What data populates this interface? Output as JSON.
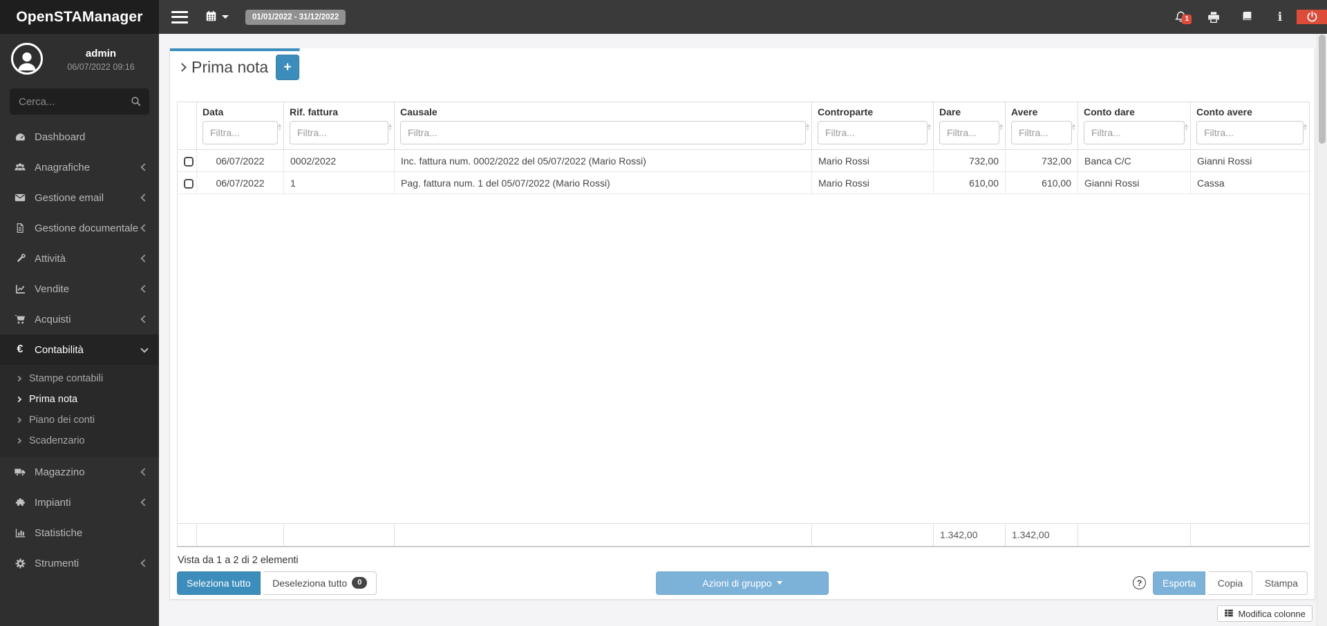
{
  "topbar": {
    "logo": "OpenSTAManager",
    "date_range": "01/01/2022 - 31/12/2022",
    "notification_count": "1"
  },
  "user": {
    "name": "admin",
    "last_login": "06/07/2022 09:16"
  },
  "sidebar": {
    "search_placeholder": "Cerca...",
    "items": [
      {
        "label": "Dashboard"
      },
      {
        "label": "Anagrafiche"
      },
      {
        "label": "Gestione email"
      },
      {
        "label": "Gestione documentale"
      },
      {
        "label": "Attività"
      },
      {
        "label": "Vendite"
      },
      {
        "label": "Acquisti"
      },
      {
        "label": "Contabilità",
        "submenu": [
          "Stampe contabili",
          "Prima nota",
          "Piano dei conti",
          "Scadenzario"
        ]
      },
      {
        "label": "Magazzino"
      },
      {
        "label": "Impianti"
      },
      {
        "label": "Statistiche"
      },
      {
        "label": "Strumenti"
      }
    ]
  },
  "main": {
    "tab_title": "Prima nota",
    "add_button": "+",
    "table": {
      "filter_placeholder": "Filtra...",
      "columns": [
        "Data",
        "Rif. fattura",
        "Causale",
        "Controparte",
        "Dare",
        "Avere",
        "Conto dare",
        "Conto avere"
      ],
      "rows": [
        [
          "06/07/2022",
          "0002/2022",
          "Inc. fattura num. 0002/2022 del 05/07/2022 (Mario Rossi)",
          "Mario Rossi",
          "732,00",
          "732,00",
          "Banca C/C",
          "Gianni Rossi"
        ],
        [
          "06/07/2022",
          "1",
          "Pag. fattura num. 1 del 05/07/2022 (Mario Rossi)",
          "Mario Rossi",
          "610,00",
          "610,00",
          "Gianni Rossi",
          "Cassa"
        ]
      ],
      "totals": {
        "dare": "1.342,00",
        "avere": "1.342,00"
      }
    },
    "info_text": "Vista da 1 a 2 di 2 elementi",
    "actions": {
      "select_all": "Seleziona tutto",
      "deselect_all": "Deseleziona tutto",
      "selected_count": "0",
      "group_actions": "Azioni di gruppo",
      "export": "Esporta",
      "copy": "Copia",
      "print": "Stampa"
    },
    "edit_columns": "Modifica colonne"
  },
  "colors": {
    "accent": "#3c8dbc",
    "accent_light": "#7db2d8",
    "danger": "#dd4b39",
    "topbar_bg": "#3a3a3a",
    "sidebar_bg": "#2f2f2f"
  }
}
